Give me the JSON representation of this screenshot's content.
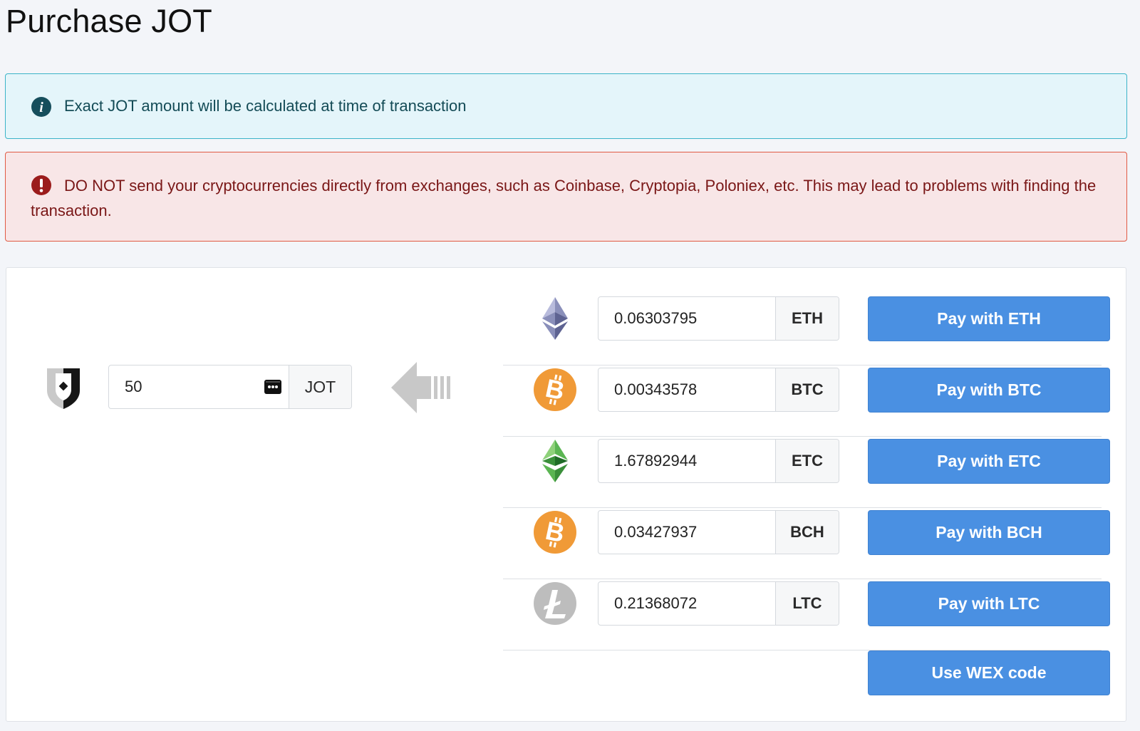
{
  "page": {
    "title": "Purchase JOT"
  },
  "alerts": {
    "info": {
      "icon": "info-icon",
      "text": "Exact JOT amount will be calculated at time of transaction",
      "color": "#e4f5fa"
    },
    "danger": {
      "icon": "exclamation-icon",
      "text": "DO NOT send your cryptocurrencies directly from exchanges, such as Coinbase, Cryptopia, Poloniex, etc. This may lead to problems with finding the transaction.",
      "color": "#f8e6e7"
    }
  },
  "jot": {
    "icon": "jot-shield-logo",
    "amount": "50",
    "unit": "JOT"
  },
  "conversion_arrow_icon": "left-arrow-icon",
  "currencies": [
    {
      "code": "ETH",
      "icon": "ethereum-icon",
      "amount": "0.06303795",
      "button_label": "Pay with ETH"
    },
    {
      "code": "BTC",
      "icon": "bitcoin-icon",
      "amount": "0.00343578",
      "button_label": "Pay with BTC"
    },
    {
      "code": "ETC",
      "icon": "ethereum-classic-icon",
      "amount": "1.67892944",
      "button_label": "Pay with ETC"
    },
    {
      "code": "BCH",
      "icon": "bitcoin-cash-icon",
      "amount": "0.03427937",
      "button_label": "Pay with BCH"
    },
    {
      "code": "LTC",
      "icon": "litecoin-icon",
      "amount": "0.21368072",
      "button_label": "Pay with LTC"
    }
  ],
  "wex_button_label": "Use WEX code",
  "colors": {
    "accent": "#4a90e2",
    "bitcoin_orange": "#f09a37",
    "info_border": "#3bb4c8",
    "danger_border": "#e05a44",
    "page_background": "#f3f5f9"
  }
}
